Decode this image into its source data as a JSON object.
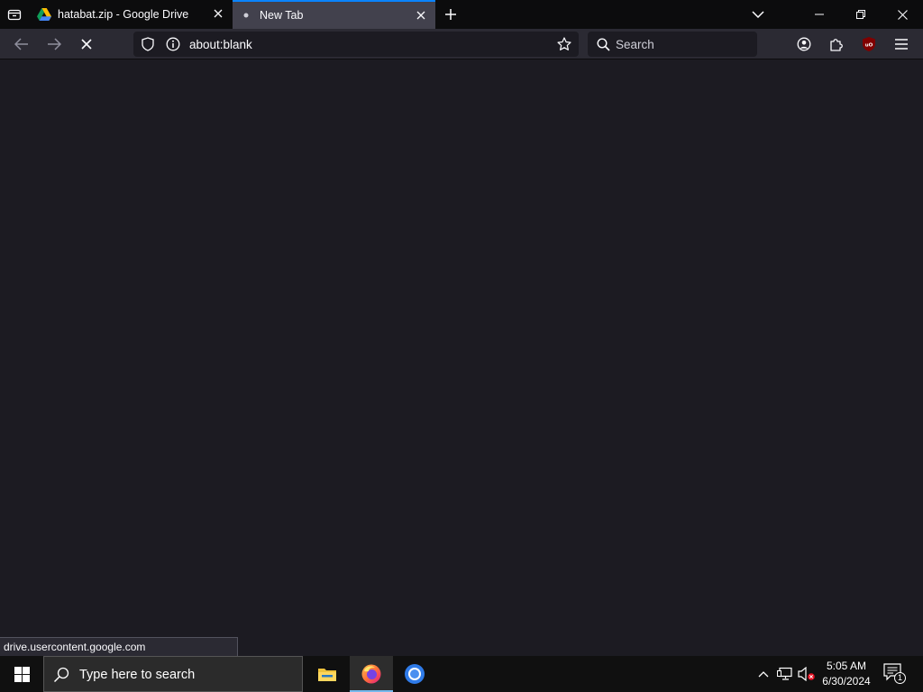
{
  "tabs": [
    {
      "title": "hatabat.zip - Google Drive",
      "icon": "google-drive-icon",
      "selected": false
    },
    {
      "title": "New Tab",
      "icon": "loading-dot-icon",
      "selected": true
    }
  ],
  "navbar": {
    "url": "about:blank",
    "search_placeholder": "Search",
    "accent_color": "#0a84ff"
  },
  "status": {
    "link_url": "drive.usercontent.google.com"
  },
  "taskbar": {
    "search_placeholder": "Type here to search",
    "apps": [
      "file-explorer-icon",
      "firefox-icon",
      "chrome-icon"
    ],
    "active_app": "firefox-icon",
    "time": "5:05 AM",
    "date": "6/30/2024",
    "notification_count": "1"
  }
}
